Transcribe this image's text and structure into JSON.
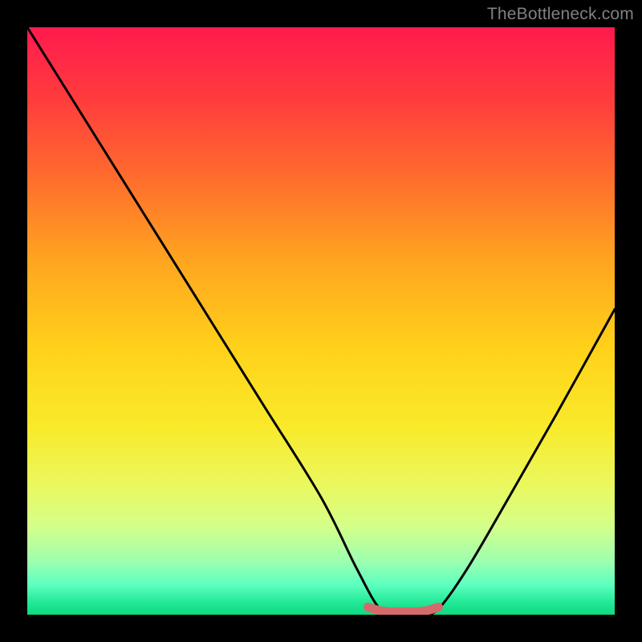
{
  "watermark": "TheBottleneck.com",
  "chart_data": {
    "type": "line",
    "title": "",
    "xlabel": "",
    "ylabel": "",
    "xlim": [
      0,
      100
    ],
    "ylim": [
      0,
      100
    ],
    "series": [
      {
        "name": "bottleneck-curve",
        "x": [
          0,
          10,
          20,
          30,
          40,
          50,
          56,
          60,
          63,
          67,
          70,
          75,
          82,
          90,
          100
        ],
        "values": [
          100,
          84,
          68,
          52,
          36,
          20,
          8,
          1,
          0,
          0,
          1,
          8,
          20,
          34,
          52
        ]
      },
      {
        "name": "highlight-segment",
        "x": [
          58,
          60,
          62,
          64,
          66,
          68,
          70
        ],
        "values": [
          1.3,
          0.7,
          0.5,
          0.5,
          0.5,
          0.7,
          1.3
        ]
      }
    ],
    "colors": {
      "curve": "#000000",
      "highlight": "#d46a6a",
      "gradient_top": "#ff1a4d",
      "gradient_bottom": "#0fd880"
    }
  }
}
